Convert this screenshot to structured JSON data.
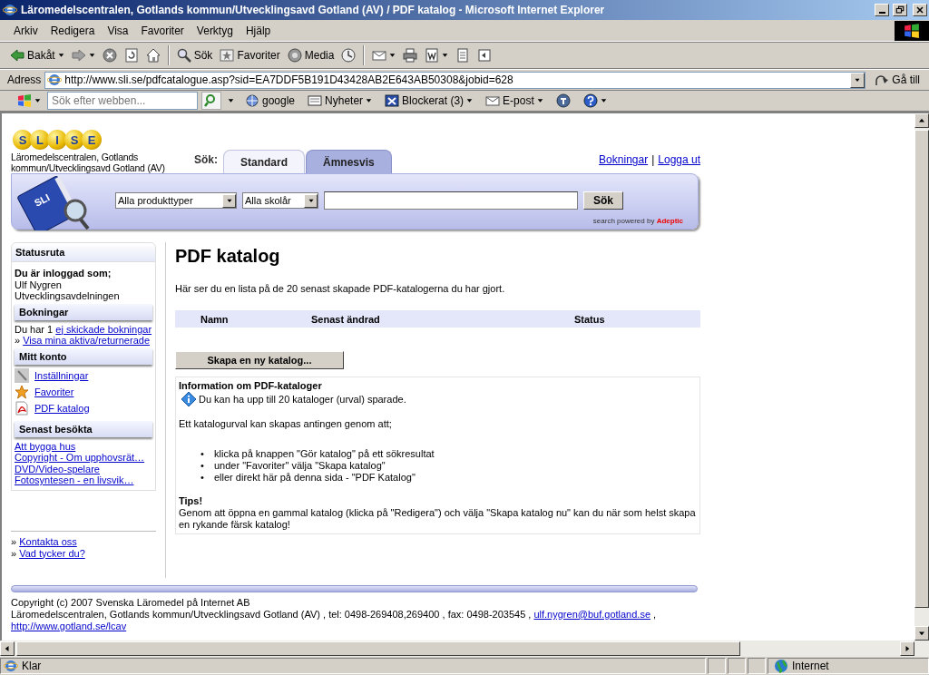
{
  "window": {
    "title": "Läromedelscentralen, Gotlands kommun/Utvecklingsavd Gotland (AV) / PDF katalog - Microsoft Internet Explorer"
  },
  "menu": [
    "Arkiv",
    "Redigera",
    "Visa",
    "Favoriter",
    "Verktyg",
    "Hjälp"
  ],
  "toolbar": [
    {
      "kind": "back",
      "label": "Bakåt",
      "dropdown": true
    },
    {
      "kind": "forward",
      "dropdown": true
    },
    {
      "kind": "stop",
      "dropdown": false
    },
    {
      "kind": "refresh",
      "dropdown": false
    },
    {
      "kind": "home",
      "dropdown": false
    },
    {
      "kind": "separator"
    },
    {
      "kind": "search",
      "label": "Sök",
      "dropdown": false
    },
    {
      "kind": "favorites",
      "label": "Favoriter",
      "dropdown": false
    },
    {
      "kind": "media",
      "label": "Media",
      "dropdown": false
    },
    {
      "kind": "history",
      "dropdown": false
    },
    {
      "kind": "separator"
    },
    {
      "kind": "mail",
      "dropdown": true
    },
    {
      "kind": "print",
      "dropdown": false
    },
    {
      "kind": "word",
      "dropdown": true
    },
    {
      "kind": "edit",
      "dropdown": false
    },
    {
      "kind": "discuss",
      "dropdown": false
    }
  ],
  "address": {
    "label": "Adress",
    "url": "http://www.sli.se/pdfcatalogue.asp?sid=EA7DDF5B191D43428AB2E643AB50308&jobid=628",
    "go": "Gå till"
  },
  "links_bar": {
    "search_placeholder": "Sök efter webben...",
    "items": [
      {
        "kind": "google",
        "label": "google",
        "dropdown": false
      },
      {
        "kind": "news",
        "label": "Nyheter",
        "dropdown": true
      },
      {
        "kind": "blocked",
        "label": "Blockerat (3)",
        "dropdown": true
      },
      {
        "kind": "mail",
        "label": "E-post",
        "dropdown": true
      },
      {
        "kind": "tbutton",
        "dropdown": false
      },
      {
        "kind": "help",
        "dropdown": true
      }
    ]
  },
  "page": {
    "logo_letters": [
      "S",
      "L",
      "I",
      "S",
      "E"
    ],
    "org_name": "Läromedelscentralen, Gotlands kommun/Utvecklingsavd Gotland (AV)",
    "search_label": "Sök:",
    "tabs": [
      {
        "label": "Standard",
        "selected": true
      },
      {
        "label": "Ämnesvis",
        "selected": false
      }
    ],
    "top_links": [
      "Bokningar",
      "Logga ut"
    ],
    "top_links_separator": "|",
    "search": {
      "book_label": "SLI",
      "product_type": "Alla produkttyper",
      "school_year": "Alla skolår",
      "button": "Sök",
      "powered_by": "search powered by",
      "brand": "Adeptic"
    },
    "sidebar": {
      "title": "Statusruta",
      "logged_in_label": "Du är inloggad som;",
      "user": "Ulf Nygren",
      "department": "Utvecklingsavdelningen",
      "bookings": {
        "title": "Bokningar",
        "text": "Du har 1",
        "link": "ej skickade bokningar",
        "prefix": "»",
        "link2": "Visa mina aktiva/returnerade"
      },
      "account": {
        "title": "Mitt konto",
        "items": [
          {
            "kind": "wrench",
            "label": "Inställningar"
          },
          {
            "kind": "star",
            "label": "Favoriter"
          },
          {
            "kind": "pdf",
            "label": "PDF katalog"
          }
        ]
      },
      "recent": {
        "title": "Senast besökta",
        "items": [
          "Att bygga hus",
          "Copyright - Om upphovsrät…",
          "DVD/Video-spelare",
          "Fotosyntesen - en livsvik…"
        ]
      },
      "bottom_links": [
        {
          "prefix": "»",
          "label": "Kontakta oss"
        },
        {
          "prefix": "»",
          "label": "Vad tycker du?"
        }
      ]
    },
    "main": {
      "title": "PDF katalog",
      "intro": "Här ser du en lista på de 20 senast skapade PDF-katalogerna du har gjort.",
      "table": {
        "columns": [
          "Namn",
          "Senast ändrad",
          "Status"
        ]
      },
      "create_button": "Skapa en ny katalog...",
      "info": {
        "title": "Information om PDF-kataloger",
        "note": "Du kan ha upp till 20 kataloger (urval) sparade.",
        "text": "Ett katalogurval kan skapas antingen genom att;",
        "bullet_mark": "•",
        "bullets": [
          "klicka på knappen \"Gör katalog\" på ett sökresultat",
          "under \"Favoriter\" välja \"Skapa katalog\"",
          "eller direkt här på denna sida - \"PDF Katalog\""
        ],
        "tips_title": "Tips!",
        "tips": "Genom att öppna en gammal katalog (klicka på \"Redigera\") och välja \"Skapa katalog nu\" kan du när som helst skapa en rykande färsk katalog!"
      }
    },
    "footer": {
      "copyright": "Copyright (c) 2007 Svenska Läromedel på Internet AB",
      "contact": "Läromedelscentralen, Gotlands kommun/Utvecklingsavd Gotland (AV) , tel: 0498-269408,269400 , fax: 0498-203545 ,",
      "email": "ulf.nygren@buf.gotland.se",
      "after_email": ",",
      "url": "http://www.gotland.se/lcav"
    }
  },
  "status_bar": {
    "text": "Klar",
    "zone": "Internet"
  }
}
